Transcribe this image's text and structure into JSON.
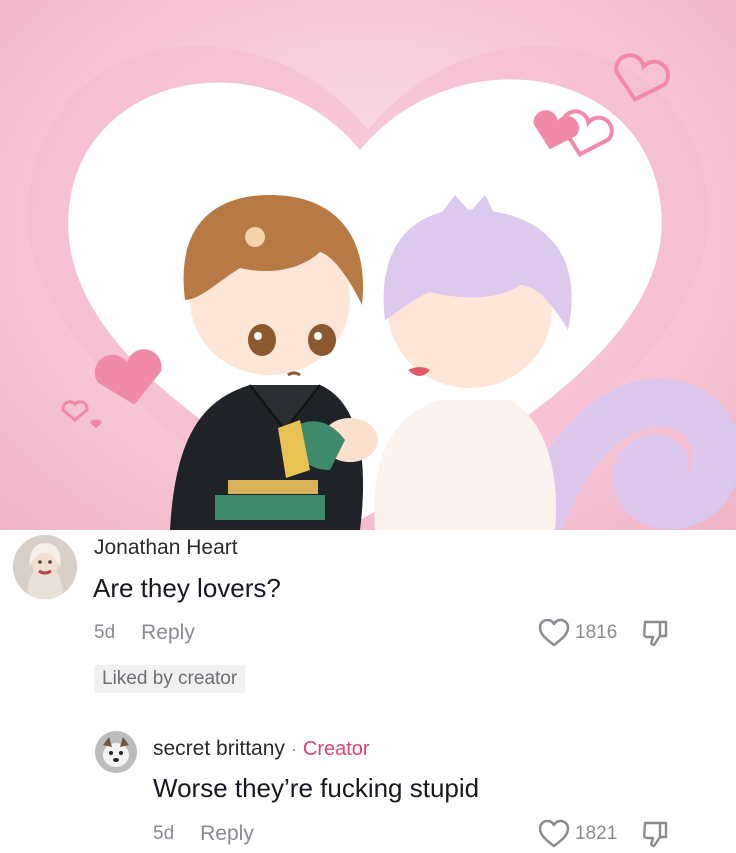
{
  "illustration": {
    "background_color": "#f7c9d8",
    "heart_color": "#ffffff",
    "decor_heart_color": "#f08aa8"
  },
  "comments": [
    {
      "username": "Jonathan Heart",
      "text": "Are they lovers?",
      "time": "5d",
      "reply_label": "Reply",
      "likes": "1816",
      "badge": "Liked by creator",
      "avatar_icon": "person-avatar-icon"
    },
    {
      "username": "secret brittany",
      "separator": "·",
      "creator_label": "Creator",
      "text": "Worse they’re fucking stupid",
      "time": "5d",
      "reply_label": "Reply",
      "likes": "1821",
      "avatar_icon": "dog-avatar-icon"
    }
  ],
  "colors": {
    "creator": "#e0436d",
    "muted": "#8a8b91",
    "text": "#161823"
  }
}
